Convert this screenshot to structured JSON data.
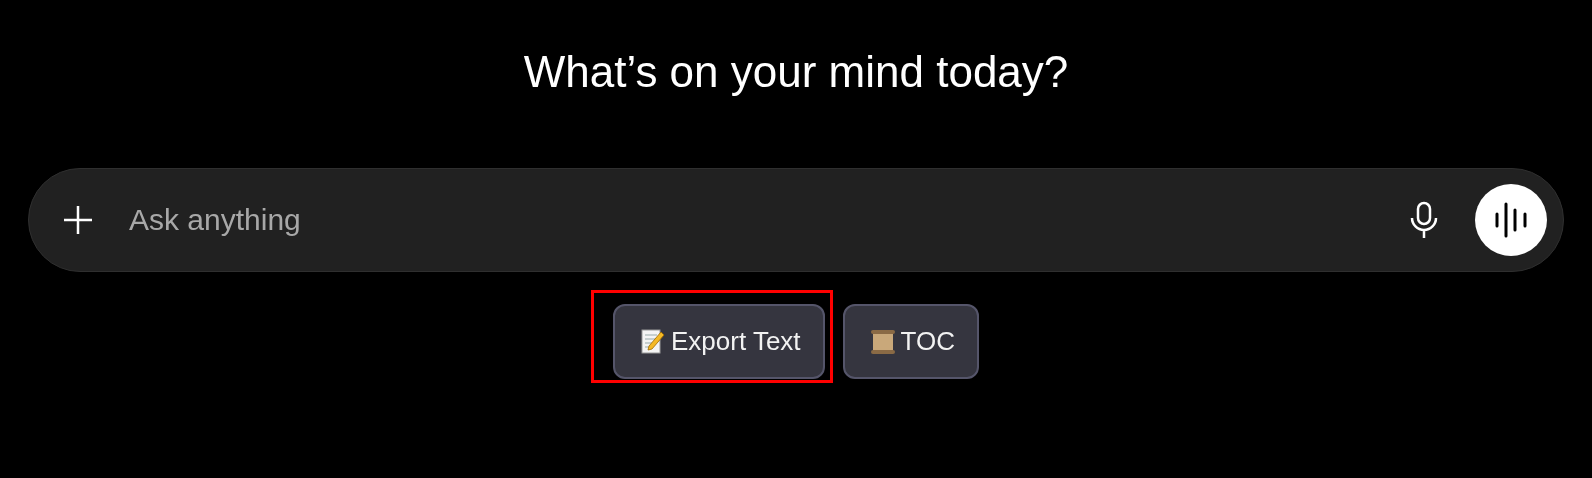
{
  "heading": "What’s on your mind today?",
  "composer": {
    "placeholder": "Ask anything"
  },
  "actions": [
    {
      "kind": "memo",
      "label": "Export Text",
      "highlighted": true
    },
    {
      "kind": "scroll",
      "label": "TOC",
      "highlighted": false
    }
  ]
}
